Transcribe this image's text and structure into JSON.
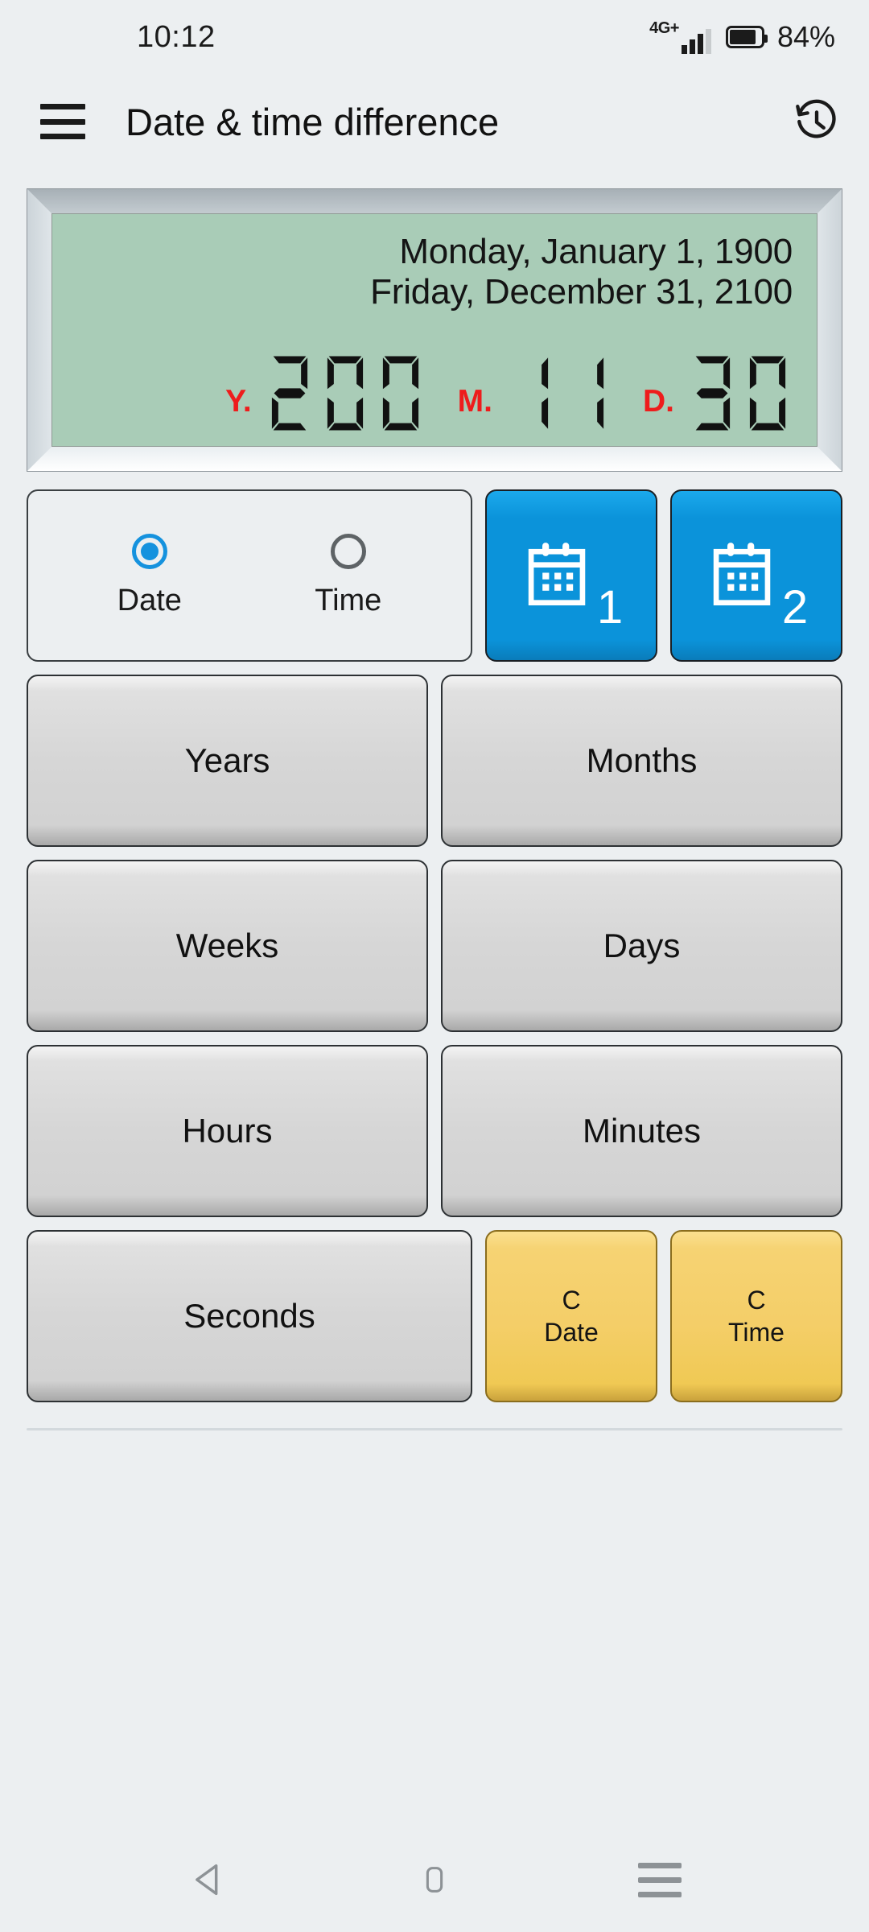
{
  "status_bar": {
    "clock": "10:12",
    "network_label": "4G+",
    "battery_percent": "84%",
    "signal_icon": "signal-bars-icon",
    "battery_icon": "battery-icon"
  },
  "app_bar": {
    "menu_icon": "hamburger-menu-icon",
    "title": "Date & time difference",
    "history_icon": "history-clock-icon"
  },
  "display": {
    "date_line_1": "Monday, January 1, 1900",
    "date_line_2": "Friday, December 31, 2100",
    "segments": [
      {
        "unit": "Y.",
        "value": "200"
      },
      {
        "unit": "M.",
        "value": "11"
      },
      {
        "unit": "D.",
        "value": "30"
      }
    ],
    "screen_color": "#a9ccb7",
    "unit_color": "#ee1c1c"
  },
  "mode_selector": {
    "options": [
      {
        "label": "Date",
        "selected": true
      },
      {
        "label": "Time",
        "selected": false
      }
    ]
  },
  "calendar_buttons": [
    {
      "icon": "calendar-icon",
      "number": "1"
    },
    {
      "icon": "calendar-icon",
      "number": "2"
    }
  ],
  "unit_buttons": [
    {
      "label": "Years"
    },
    {
      "label": "Months"
    },
    {
      "label": "Weeks"
    },
    {
      "label": "Days"
    },
    {
      "label": "Hours"
    },
    {
      "label": "Minutes"
    },
    {
      "label": "Seconds"
    }
  ],
  "clear_buttons": [
    {
      "line1": "C",
      "line2": "Date"
    },
    {
      "line1": "C",
      "line2": "Time"
    }
  ],
  "nav_bar": {
    "back_icon": "back-triangle-icon",
    "home_icon": "home-square-icon",
    "recents_icon": "recents-lines-icon"
  },
  "colors": {
    "accent_blue": "#0b93da",
    "clear_yellow": "#f4ce68",
    "page_background": "#eceff1"
  }
}
